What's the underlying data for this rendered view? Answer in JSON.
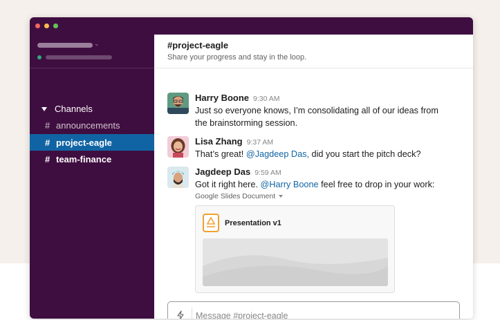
{
  "colors": {
    "sidebar_bg": "#3f0e40",
    "active_channel": "#1164a3",
    "mention": "#1264a3",
    "window_red": "#ed6a5e",
    "window_yellow": "#f5bf4f",
    "window_green": "#61c554",
    "presence_green": "#2bac76",
    "slides_orange": "#f0a030"
  },
  "sidebar": {
    "section_label": "Channels",
    "channels": [
      {
        "hash": "#",
        "name": "announcements",
        "state": "normal"
      },
      {
        "hash": "#",
        "name": "project-eagle",
        "state": "active"
      },
      {
        "hash": "#",
        "name": "team-finance",
        "state": "unread"
      }
    ]
  },
  "channel": {
    "title": "#project-eagle",
    "topic": "Share your progress and stay in the loop."
  },
  "messages": [
    {
      "author": "Harry Boone",
      "time": "9:30 AM",
      "lines": [
        "Just so everyone knows, I’m consolidating all of our ideas from",
        "the brainstorming session."
      ]
    },
    {
      "author": "Lisa Zhang",
      "time": "9:37 AM",
      "text_before": "That’s great! ",
      "mention": "@Jagdeep Das,",
      "text_after": " did you start the pitch deck?"
    },
    {
      "author": "Jagdeep Das",
      "time": "9:59 AM",
      "text_before": "Got it right here. ",
      "mention": "@Harry Boone",
      "text_after": " feel free to drop in your work:",
      "attachment_label": "Google Slides Document",
      "attachment_title": "Presentation v1"
    }
  ],
  "composer": {
    "placeholder": "Message #project-eagle",
    "shortcut_icon": "lightning-bolt-icon"
  }
}
